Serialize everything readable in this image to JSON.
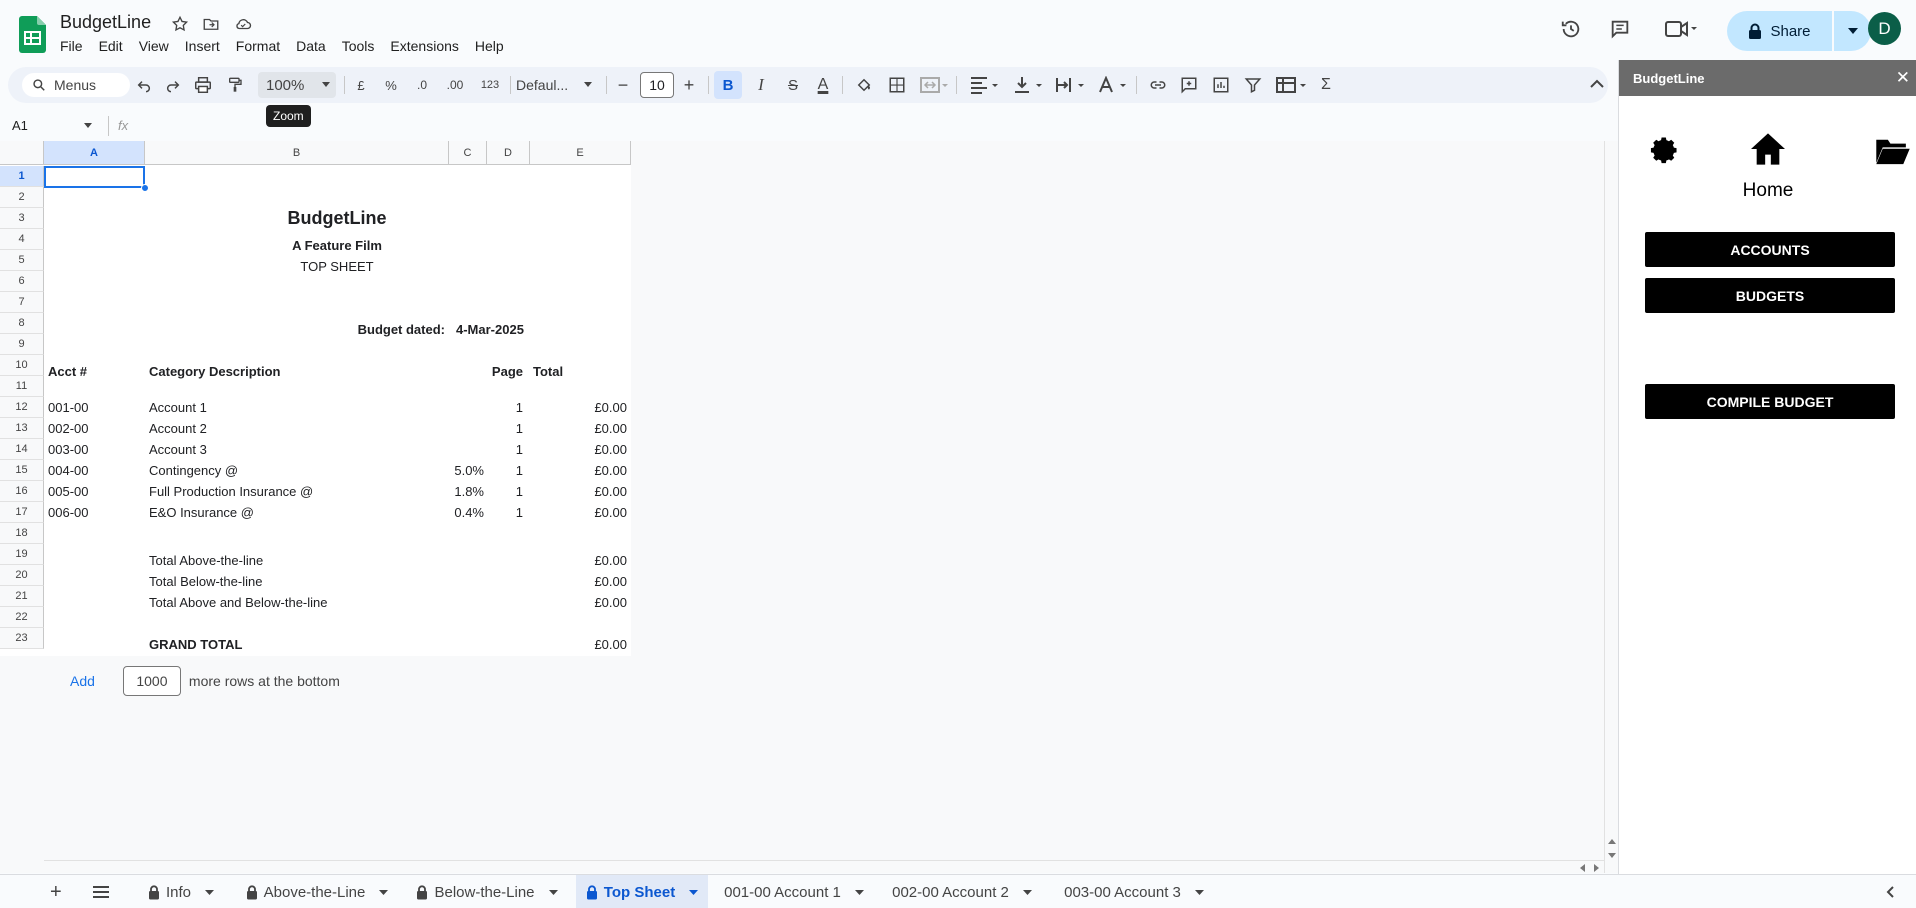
{
  "app": {
    "title": "BudgetLine"
  },
  "menu": [
    "File",
    "Edit",
    "View",
    "Insert",
    "Format",
    "Data",
    "Tools",
    "Extensions",
    "Help"
  ],
  "header": {
    "share_label": "Share",
    "avatar_initial": "D"
  },
  "toolbar": {
    "search_label": "Menus",
    "zoom": "100%",
    "currency": "£",
    "percent": "%",
    "dec_decrease": ".0",
    "dec_increase": ".00",
    "number_format": "123",
    "font": "Defaul...",
    "font_size": "10",
    "bold": "B",
    "italic": "I",
    "text_color": "A",
    "sigma": "Σ",
    "tooltip": "Zoom"
  },
  "formula_bar": {
    "name_box": "A1",
    "fx": "fx"
  },
  "columns": [
    "A",
    "B",
    "C",
    "D",
    "E"
  ],
  "rows": [
    "1",
    "2",
    "3",
    "4",
    "5",
    "6",
    "7",
    "8",
    "9",
    "10",
    "11",
    "12",
    "13",
    "14",
    "15",
    "16",
    "17",
    "18",
    "19",
    "20",
    "21",
    "22",
    "23"
  ],
  "sheet": {
    "title": "BudgetLine",
    "subtitle": "A Feature Film",
    "sheet_name": "TOP SHEET",
    "budget_dated_label": "Budget dated:",
    "budget_date": "4-Mar-2025",
    "headers": {
      "acct": "Acct #",
      "category": "Category Description",
      "page": "Page",
      "total": "Total"
    },
    "lines": [
      {
        "acct": "001-00",
        "desc": "Account 1",
        "pct": "",
        "page": "1",
        "total": "£0.00"
      },
      {
        "acct": "002-00",
        "desc": "Account 2",
        "pct": "",
        "page": "1",
        "total": "£0.00"
      },
      {
        "acct": "003-00",
        "desc": "Account 3",
        "pct": "",
        "page": "1",
        "total": "£0.00"
      },
      {
        "acct": "004-00",
        "desc": "Contingency @",
        "pct": "5.0%",
        "page": "1",
        "total": "£0.00"
      },
      {
        "acct": "005-00",
        "desc": "Full Production Insurance @",
        "pct": "1.8%",
        "page": "1",
        "total": "£0.00"
      },
      {
        "acct": "006-00",
        "desc": "E&O Insurance @",
        "pct": "0.4%",
        "page": "1",
        "total": "£0.00"
      }
    ],
    "totals": [
      {
        "desc": "Total Above-the-line",
        "total": "£0.00"
      },
      {
        "desc": "Total Below-the-line",
        "total": "£0.00"
      },
      {
        "desc": "Total Above and Below-the-line",
        "total": "£0.00"
      }
    ],
    "grand_total": {
      "desc": "GRAND TOTAL",
      "total": "£0.00"
    }
  },
  "add_rows": {
    "button": "Add",
    "count": "1000",
    "suffix": "more rows at the bottom"
  },
  "tabs": [
    {
      "label": "Info",
      "locked": true
    },
    {
      "label": "Above-the-Line",
      "locked": true
    },
    {
      "label": "Below-the-Line",
      "locked": true
    },
    {
      "label": "Top Sheet",
      "locked": true,
      "active": true
    },
    {
      "label": "001-00 Account 1",
      "locked": false
    },
    {
      "label": "002-00 Account 2",
      "locked": false
    },
    {
      "label": "003-00 Account 3",
      "locked": false
    }
  ],
  "panel": {
    "title": "BudgetLine",
    "home_label": "Home",
    "buttons": [
      "ACCOUNTS",
      "BUDGETS",
      "COMPILE BUDGET"
    ]
  },
  "colors": {
    "accent": "#1a73e8",
    "share_bg": "#c2e7ff",
    "sheets_green": "#0f9d58"
  }
}
